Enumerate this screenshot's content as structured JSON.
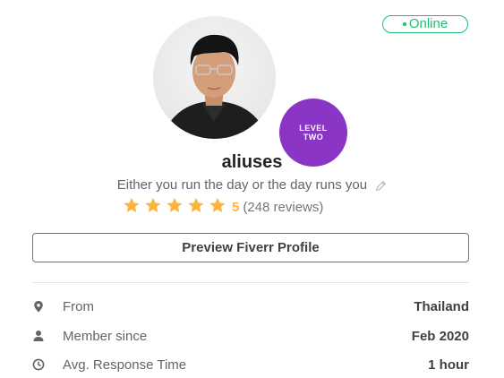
{
  "status": {
    "label": "Online",
    "color": "#1dbf73"
  },
  "profile": {
    "username": "aliuses",
    "tagline": "Either you run the day or the day runs you",
    "level_line1": "LEVEL",
    "level_line2": "TWO"
  },
  "rating": {
    "score": "5",
    "reviews": "(248 reviews)",
    "stars_filled": 5,
    "stars_total": 5,
    "star_color": "#ffb33e"
  },
  "actions": {
    "preview_label": "Preview Fiverr Profile"
  },
  "stats": [
    {
      "icon": "location-pin-icon",
      "label": "From",
      "value": "Thailand"
    },
    {
      "icon": "user-icon",
      "label": "Member since",
      "value": "Feb 2020"
    },
    {
      "icon": "clock-icon",
      "label": "Avg. Response Time",
      "value": "1 hour"
    }
  ]
}
